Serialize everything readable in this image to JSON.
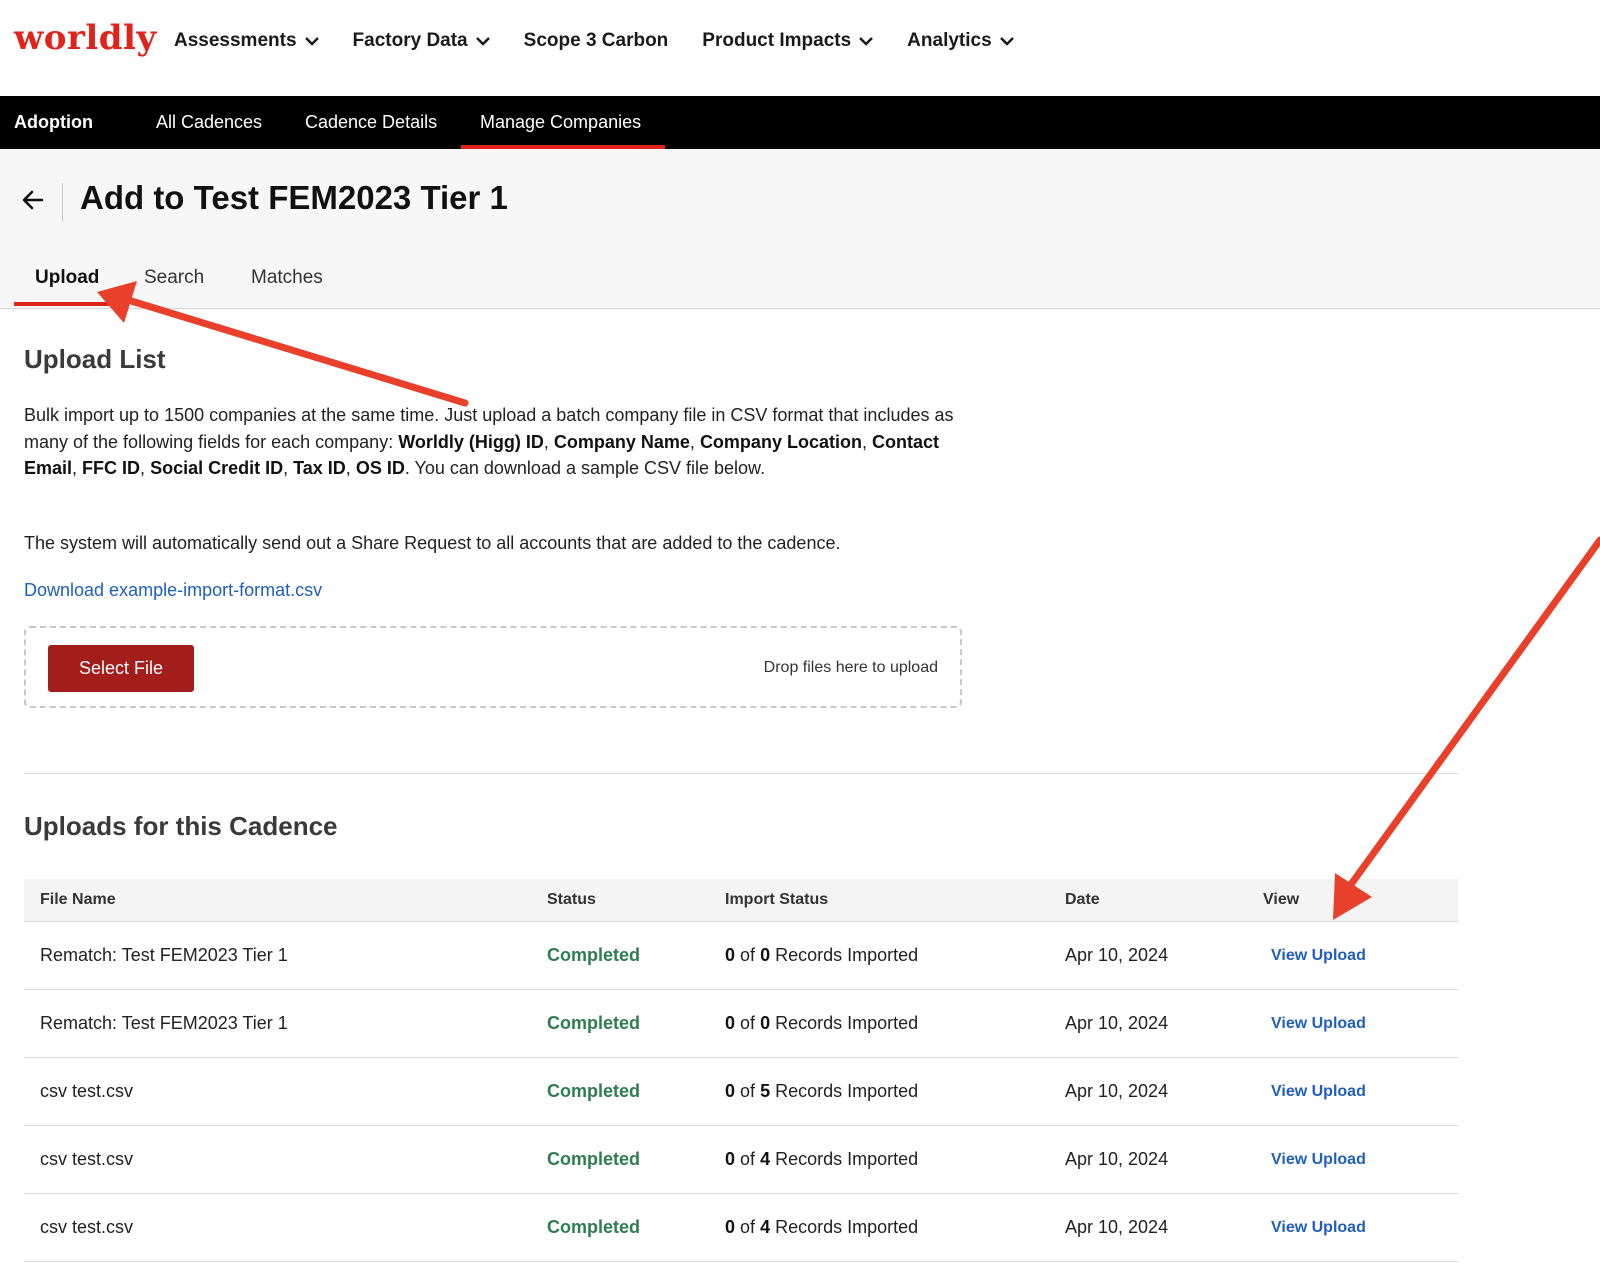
{
  "brand": {
    "logo": "worldly",
    "color": "#e0241b"
  },
  "topnav": {
    "items": [
      {
        "label": "Assessments",
        "dropdown": true
      },
      {
        "label": "Factory Data",
        "dropdown": true
      },
      {
        "label": "Scope 3 Carbon",
        "dropdown": false
      },
      {
        "label": "Product Impacts",
        "dropdown": true
      },
      {
        "label": "Analytics",
        "dropdown": true
      }
    ]
  },
  "subnav": {
    "section": "Adoption",
    "tabs": [
      {
        "label": "All Cadences"
      },
      {
        "label": "Cadence Details"
      },
      {
        "label": "Manage Companies",
        "active": true
      }
    ]
  },
  "header": {
    "title": "Add to Test FEM2023 Tier 1",
    "tabs": [
      {
        "label": "Upload",
        "active": true
      },
      {
        "label": "Search"
      },
      {
        "label": "Matches"
      }
    ]
  },
  "upload": {
    "heading": "Upload List",
    "desc": {
      "t1": "Bulk import up to 1500 companies at the same time. Just upload a batch company file in CSV format that includes as many of the following fields for each company: ",
      "f1": "Worldly (Higg) ID",
      "f2": "Company Name",
      "f3": "Company Location",
      "f4": "Contact Email",
      "f5": "FFC ID",
      "f6": "Social Credit ID",
      "f7": "Tax ID",
      "f8": "OS ID",
      "sep": ", ",
      "t2": ". You can download a sample CSV file below."
    },
    "note": "The system will automatically send out a Share Request to all accounts that are added to the cadence.",
    "download_link": "Download example-import-format.csv",
    "select_button": "Select File",
    "drop_note": "Drop files here to upload"
  },
  "uploads": {
    "heading": "Uploads for this Cadence",
    "columns": [
      "File Name",
      "Status",
      "Import Status",
      "Date",
      "View"
    ],
    "rows": [
      {
        "file": "Rematch: Test FEM2023 Tier 1",
        "status": "Completed",
        "imported": "0",
        "total": "0",
        "suffix": "Records Imported",
        "date": "Apr 10, 2024",
        "view": "View Upload"
      },
      {
        "file": "Rematch: Test FEM2023 Tier 1",
        "status": "Completed",
        "imported": "0",
        "total": "0",
        "suffix": "Records Imported",
        "date": "Apr 10, 2024",
        "view": "View Upload"
      },
      {
        "file": "csv test.csv",
        "status": "Completed",
        "imported": "0",
        "total": "5",
        "suffix": "Records Imported",
        "date": "Apr 10, 2024",
        "view": "View Upload"
      },
      {
        "file": "csv test.csv",
        "status": "Completed",
        "imported": "0",
        "total": "4",
        "suffix": "Records Imported",
        "date": "Apr 10, 2024",
        "view": "View Upload"
      },
      {
        "file": "csv test.csv",
        "status": "Completed",
        "imported": "0",
        "total": "4",
        "suffix": "Records Imported",
        "date": "Apr 10, 2024",
        "view": "View Upload"
      }
    ],
    "of_word": "of"
  },
  "annotation": {
    "arrow_color": "#e8402a"
  }
}
